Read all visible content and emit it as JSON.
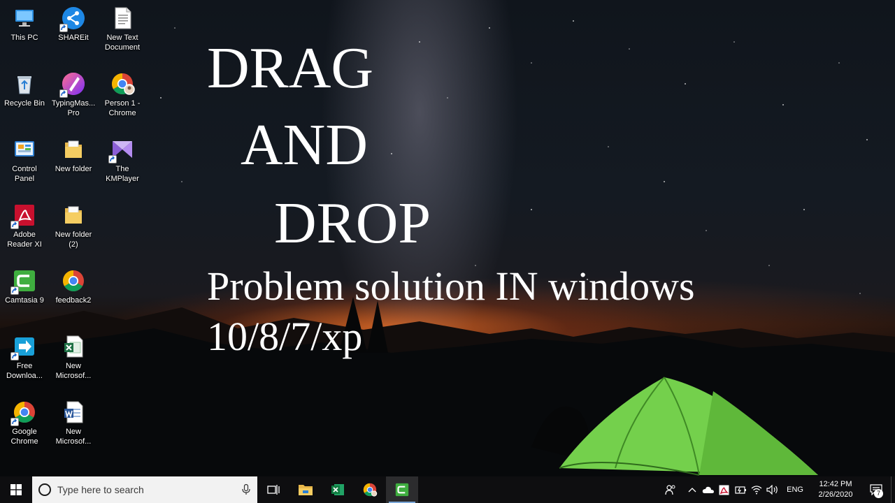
{
  "desktop": {
    "icons": [
      {
        "label": "This PC",
        "icon": "computer-icon",
        "shortcut": false
      },
      {
        "label": "SHAREit",
        "icon": "shareit-icon",
        "shortcut": true
      },
      {
        "label": "New Text\nDocument",
        "icon": "text-document-icon",
        "shortcut": false
      },
      {
        "label": "Recycle Bin",
        "icon": "recycle-bin-icon",
        "shortcut": false
      },
      {
        "label": "TypingMas...\nPro",
        "icon": "typingmaster-icon",
        "shortcut": true
      },
      {
        "label": "Person 1 -\nChrome",
        "icon": "chrome-profile-icon",
        "shortcut": false
      },
      {
        "label": "Control\nPanel",
        "icon": "control-panel-icon",
        "shortcut": false
      },
      {
        "label": "New folder",
        "icon": "folder-icon",
        "shortcut": false
      },
      {
        "label": "The\nKMPlayer",
        "icon": "kmplayer-icon",
        "shortcut": true
      },
      {
        "label": "Adobe\nReader XI",
        "icon": "adobe-reader-icon",
        "shortcut": true
      },
      {
        "label": "New folder\n(2)",
        "icon": "folder-icon",
        "shortcut": false
      },
      {
        "label": "Camtasia 9",
        "icon": "camtasia-icon",
        "shortcut": true
      },
      {
        "label": "feedback2",
        "icon": "chrome-icon",
        "shortcut": false
      },
      {
        "label": "Free\nDownloa...",
        "icon": "free-download-manager-icon",
        "shortcut": true
      },
      {
        "label": "New\nMicrosof...",
        "icon": "excel-document-icon",
        "shortcut": false
      },
      {
        "label": "Google\nChrome",
        "icon": "chrome-icon",
        "shortcut": true
      },
      {
        "label": "New\nMicrosof...",
        "icon": "word-document-icon",
        "shortcut": false
      }
    ]
  },
  "overlay": {
    "line1": "DRAG",
    "line2": "AND",
    "line3": "DROP",
    "line4": "Problem solution IN windows",
    "line5": "10/8/7/xp"
  },
  "taskbar": {
    "search_placeholder": "Type here to search",
    "pinned": [
      "task-view-icon",
      "file-explorer-icon",
      "excel-icon",
      "chrome-icon",
      "camtasia-icon"
    ],
    "tray": {
      "language": "ENG",
      "time": "12:42 PM",
      "date": "2/26/2020",
      "notification_count": "7"
    }
  },
  "colors": {
    "taskbar_bg": "#0e0e10",
    "search_bg": "#f2f2f2",
    "tent_green": "#7ed957",
    "active_underline": "#7aa7d8"
  }
}
